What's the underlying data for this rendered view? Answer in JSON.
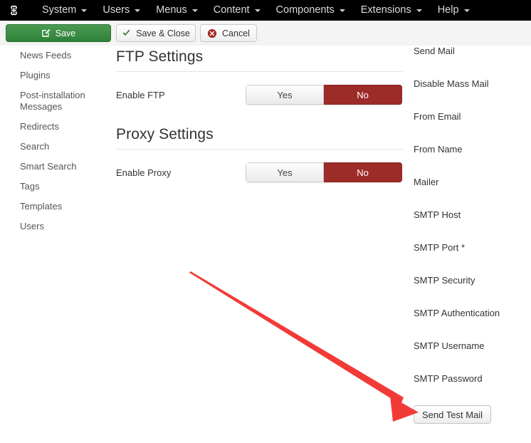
{
  "menubar": {
    "logo_icon": "joomla-logo-icon",
    "items": [
      {
        "label": "System"
      },
      {
        "label": "Users"
      },
      {
        "label": "Menus"
      },
      {
        "label": "Content"
      },
      {
        "label": "Components"
      },
      {
        "label": "Extensions"
      },
      {
        "label": "Help"
      }
    ]
  },
  "toolbar": {
    "save_label": "Save",
    "save_icon": "pencil-icon",
    "save_close_label": "Save & Close",
    "save_close_icon": "check-icon",
    "cancel_label": "Cancel",
    "cancel_icon": "cancel-circle-icon"
  },
  "sidebar": {
    "items": [
      {
        "label": "News Feeds"
      },
      {
        "label": "Plugins"
      },
      {
        "label": "Post-installation\nMessages"
      },
      {
        "label": "Redirects"
      },
      {
        "label": "Search"
      },
      {
        "label": "Smart Search"
      },
      {
        "label": "Tags"
      },
      {
        "label": "Templates"
      },
      {
        "label": "Users"
      }
    ]
  },
  "main": {
    "sections": [
      {
        "title": "FTP Settings",
        "field_label": "Enable FTP",
        "toggle": {
          "yes_label": "Yes",
          "no_label": "No",
          "selected": "No"
        }
      },
      {
        "title": "Proxy Settings",
        "field_label": "Enable Proxy",
        "toggle": {
          "yes_label": "Yes",
          "no_label": "No",
          "selected": "No"
        }
      }
    ]
  },
  "right_column": {
    "labels": [
      {
        "label": "Send Mail"
      },
      {
        "label": "Disable Mass Mail"
      },
      {
        "label": "From Email"
      },
      {
        "label": "From Name"
      },
      {
        "label": "Mailer"
      },
      {
        "label": "SMTP Host"
      },
      {
        "label": "SMTP Port *"
      },
      {
        "label": "SMTP Security"
      },
      {
        "label": "SMTP Authentication"
      },
      {
        "label": "SMTP Username"
      },
      {
        "label": "SMTP Password"
      }
    ],
    "send_test_mail_label": "Send Test Mail"
  },
  "annotation": {
    "arrow_color": "#F23B37",
    "points_to": "Send Test Mail"
  },
  "colors": {
    "menubar_bg": "#000000",
    "toolbar_bg": "#F4F4F4",
    "save_green": "#2F8139",
    "toggle_active_red": "#9D2B28",
    "arrow_red": "#F23B37",
    "page_bg": "#FFFFFF"
  }
}
